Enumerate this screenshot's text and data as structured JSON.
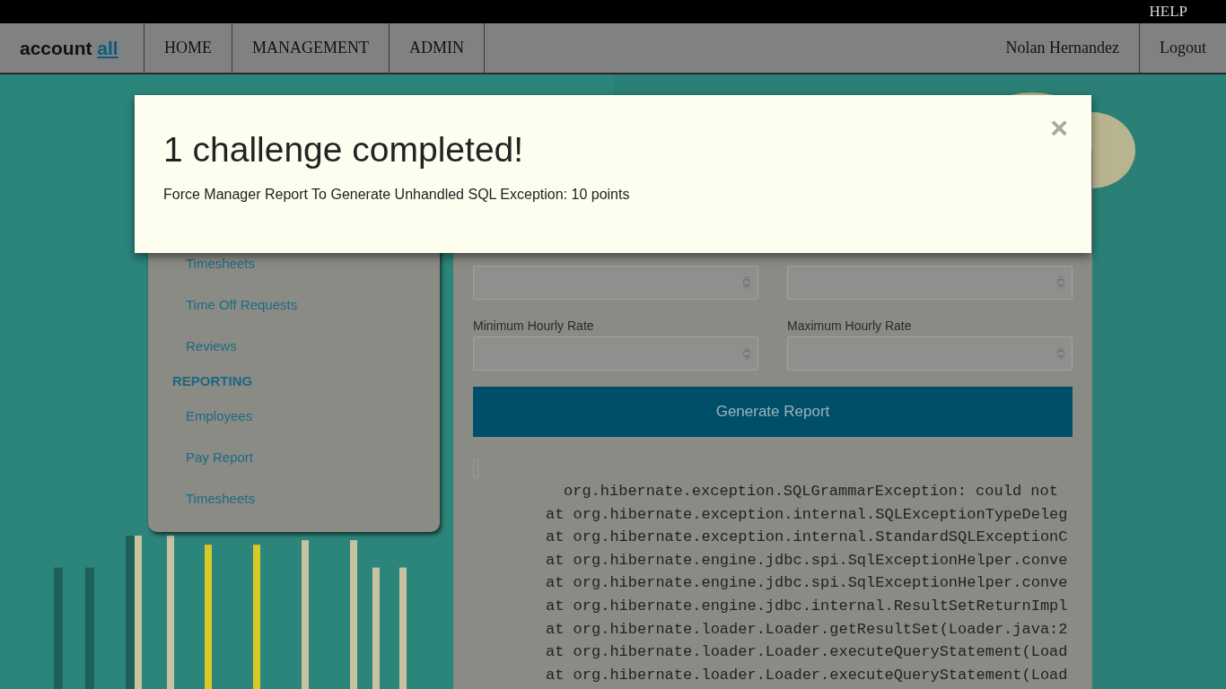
{
  "top_bar": {
    "help": "HELP"
  },
  "nav": {
    "logo": {
      "text": "account",
      "accent": "all"
    },
    "items": [
      {
        "label": "HOME"
      },
      {
        "label": "MANAGEMENT"
      },
      {
        "label": "ADMIN"
      }
    ],
    "user": "Nolan Hernandez",
    "logout": "Logout"
  },
  "sidebar": {
    "items": [
      {
        "kind": "link",
        "label": "Timesheets"
      },
      {
        "kind": "link",
        "label": "Time Off Requests"
      },
      {
        "kind": "link",
        "label": "Reviews"
      },
      {
        "kind": "heading",
        "label": "REPORTING"
      },
      {
        "kind": "link",
        "label": "Employees"
      },
      {
        "kind": "link",
        "label": "Pay Report"
      },
      {
        "kind": "link",
        "label": "Timesheets"
      }
    ]
  },
  "report_form": {
    "fields": [
      {
        "kind": "number"
      },
      {
        "kind": "number"
      },
      {
        "kind": "number",
        "label": "Minimum Hourly Rate"
      },
      {
        "kind": "number",
        "label": "Maximum Hourly Rate"
      }
    ],
    "button": "Generate Report"
  },
  "output": {
    "lines": [
      {
        "kind": "message",
        "text": "org.hibernate.exception.SQLGrammarException: could not"
      },
      {
        "kind": "frame",
        "text": "at org.hibernate.exception.internal.SQLExceptionTypeDeleg"
      },
      {
        "kind": "frame",
        "text": "at org.hibernate.exception.internal.StandardSQLExceptionC"
      },
      {
        "kind": "frame",
        "text": "at org.hibernate.engine.jdbc.spi.SqlExceptionHelper.conve"
      },
      {
        "kind": "frame",
        "text": "at org.hibernate.engine.jdbc.spi.SqlExceptionHelper.conve"
      },
      {
        "kind": "frame",
        "text": "at org.hibernate.engine.jdbc.internal.ResultSetReturnImpl"
      },
      {
        "kind": "frame",
        "text": "at org.hibernate.loader.Loader.getResultSet(Loader.java:2"
      },
      {
        "kind": "frame",
        "text": "at org.hibernate.loader.Loader.executeQueryStatement(Load"
      },
      {
        "kind": "frame",
        "text": "at org.hibernate.loader.Loader.executeQueryStatement(Load"
      }
    ]
  },
  "modal": {
    "title": "1 challenge completed!",
    "message": "Force Manager Report To Generate Unhandled SQL Exception: 10 points",
    "close": "×"
  }
}
